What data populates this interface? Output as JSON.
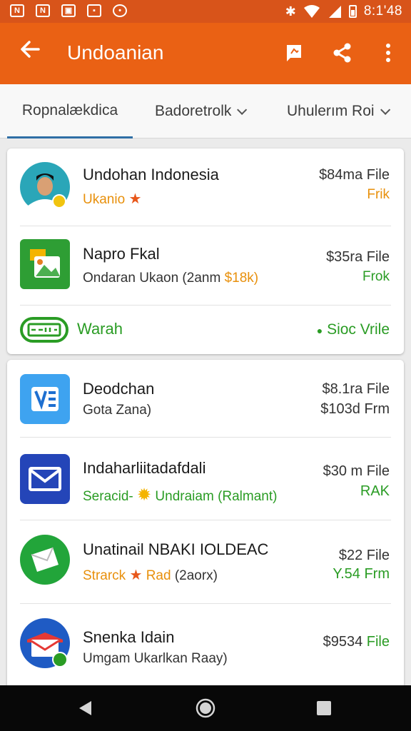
{
  "status_bar": {
    "time": "8:1'48"
  },
  "app_bar": {
    "title": "Undoanian"
  },
  "tabs": [
    {
      "label": "Ropnalækdica",
      "active": true
    },
    {
      "label": "Badoretrolk"
    },
    {
      "label": "Uhulerım Roi"
    }
  ],
  "featured": [
    {
      "name": "Undohan Indonesia",
      "subtitle": "Ukanio",
      "price": "$84ma File",
      "status": "Frik"
    },
    {
      "name": "Napro Fkal",
      "subtitle": "Ondaran Ukaon (2anm",
      "subtitle_accent": "$18k)",
      "price": "$35ra File",
      "status": "Frok"
    }
  ],
  "warah": {
    "label": "Warah",
    "action": "Sioc Vrile"
  },
  "list": [
    {
      "name": "Deodchan",
      "subtitle": "Gota Zana)",
      "price": "$8.1ra File",
      "price_detail": "$103d Frm"
    },
    {
      "name": "Indaharliitadafdali",
      "rating_label": "Seracid-",
      "subtitle": "Undraiam (Ralmant)",
      "price": "$30 m File",
      "status": "RAK"
    },
    {
      "name": "Unatinail NBAKI IOLDEAC",
      "rating_label": "Strarck",
      "subtitle_accent": "Rad",
      "subtitle": "(2aorx)",
      "price": "$22 File",
      "price_detail": "Y.54 Frm"
    },
    {
      "name": "Snenka Idain",
      "subtitle": "Umgam Ukarlkan Raay)",
      "price": "$9534",
      "status": "File"
    }
  ],
  "colors": {
    "status_bar": "#d8541a",
    "app_bar": "#ea6114",
    "accent_orange": "#e8900c",
    "accent_green": "#2a9c24",
    "tab_indicator": "#2f6fa5"
  }
}
